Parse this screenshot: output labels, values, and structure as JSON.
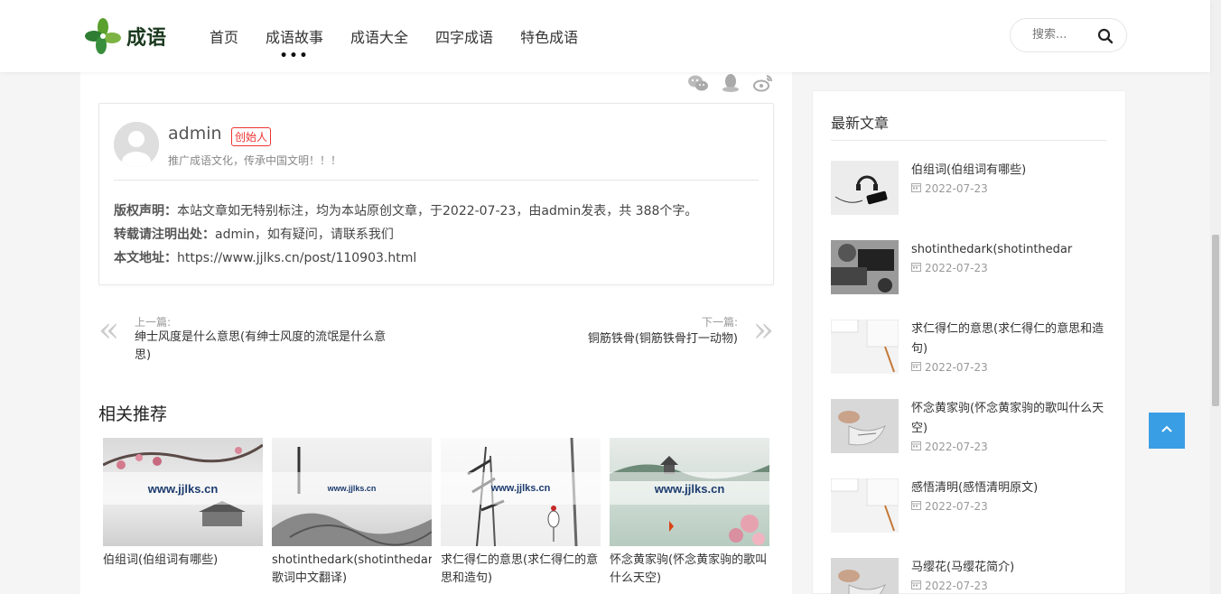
{
  "header": {
    "logo_text": "成语",
    "nav": [
      {
        "label": "首页",
        "active": false
      },
      {
        "label": "成语故事",
        "active": true
      },
      {
        "label": "成语大全",
        "active": false
      },
      {
        "label": "四字成语",
        "active": false
      },
      {
        "label": "特色成语",
        "active": false
      }
    ],
    "active_marker": "•••",
    "search_placeholder": "搜索..."
  },
  "share": [
    "wechat-icon",
    "qq-icon",
    "weibo-icon"
  ],
  "author": {
    "name": "admin",
    "badge": "创始人",
    "desc": "推广成语文化，传承中国文明！！！"
  },
  "copyright": {
    "line1_label": "版权声明：",
    "line1_text": "本站文章如无特别标注，均为本站原创文章，于2022-07-23，由admin发表，共 388个字。",
    "line2_label": "转载请注明出处：",
    "line2_text": "admin，如有疑问，请联系我们",
    "line3_label": "本文地址：",
    "line3_text": "https://www.jjlks.cn/post/110903.html"
  },
  "post_nav": {
    "prev_label": "上一篇:",
    "prev_title": "绅士风度是什么意思(有绅士风度的流氓是什么意思)",
    "next_label": "下一篇:",
    "next_title": "铜筋铁骨(铜筋铁骨打一动物)"
  },
  "related": {
    "title": "相关推荐",
    "watermark": "www.jjlks.cn",
    "items": [
      {
        "caption": "伯组词(伯组词有哪些)"
      },
      {
        "caption": "shotinthedark(shotinthedark歌词中文翻译)"
      },
      {
        "caption": "求仁得仁的意思(求仁得仁的意思和造句)"
      },
      {
        "caption": "怀念黄家驹(怀念黄家驹的歌叫什么天空)"
      }
    ]
  },
  "sidebar": {
    "title": "最新文章",
    "items": [
      {
        "title": "伯组词(伯组词有哪些)",
        "date": "2022-07-23"
      },
      {
        "title": "shotinthedark(shotinthedar",
        "date": "2022-07-23"
      },
      {
        "title": "求仁得仁的意思(求仁得仁的意思和造句)",
        "date": "2022-07-23"
      },
      {
        "title": "怀念黄家驹(怀念黄家驹的歌叫什么天空)",
        "date": "2022-07-23"
      },
      {
        "title": "感悟清明(感悟清明原文)",
        "date": "2022-07-23"
      },
      {
        "title": "马缨花(马缨花简介)",
        "date": "2022-07-23"
      }
    ]
  },
  "colors": {
    "accent": "#3a9ee4",
    "badge": "#e33333"
  }
}
